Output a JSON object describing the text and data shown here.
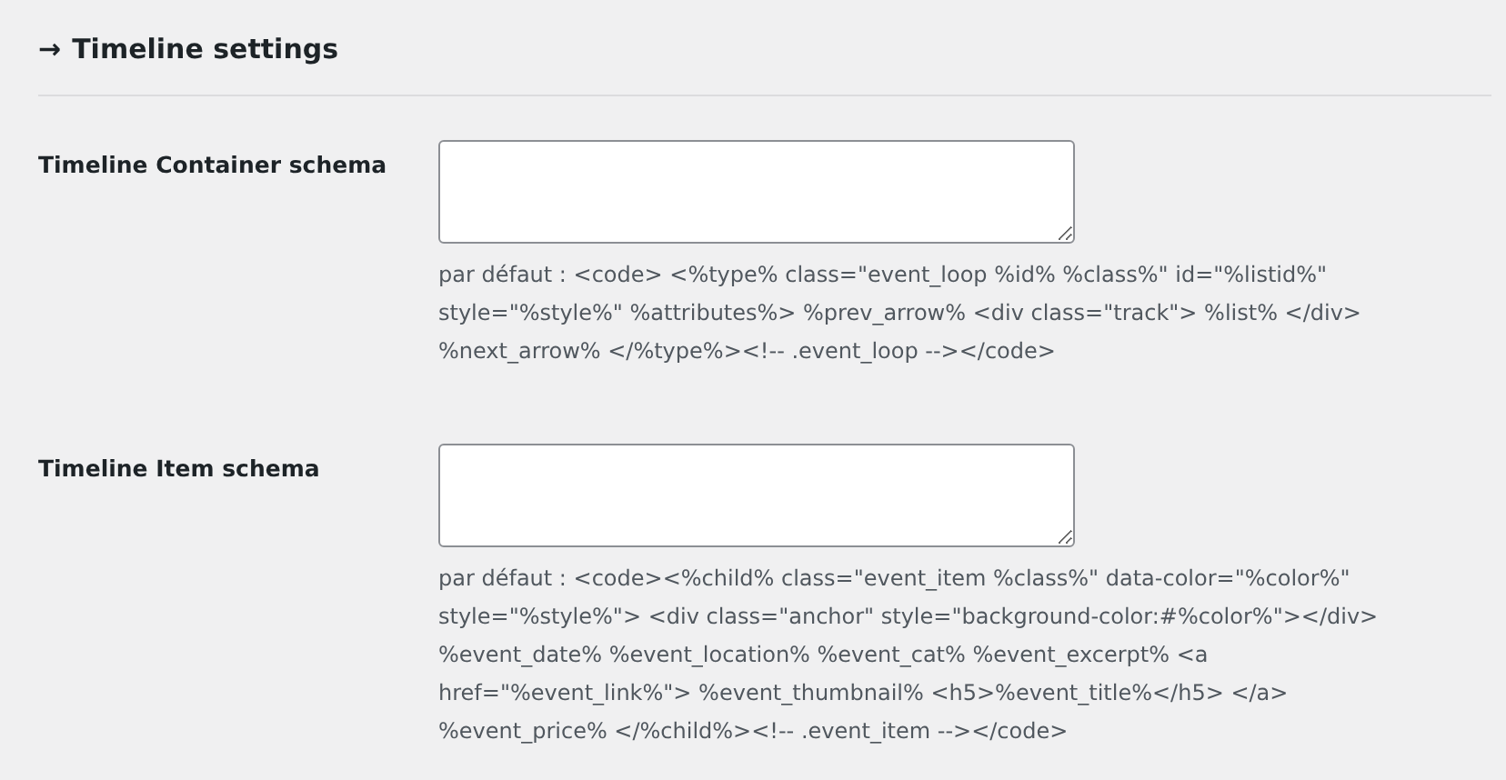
{
  "section": {
    "arrow": "→",
    "title": "Timeline settings"
  },
  "fields": [
    {
      "label": "Timeline Container schema",
      "description_lines": [
        "par défaut : <code> <%type% class=\"event_loop %id% %class%\" id=\"%listid%\"",
        "style=\"%style%\" %attributes%> %prev_arrow% <div class=\"track\"> %list% </div>",
        "%next_arrow% </%type%><!-- .event_loop --></code>"
      ]
    },
    {
      "label": "Timeline Item schema",
      "description_lines": [
        "par défaut : <code><%child% class=\"event_item %class%\" data-color=\"%color%\"",
        "style=\"%style%\"> <div class=\"anchor\" style=\"background-color:#%color%\"></div>",
        "%event_date% %event_location% %event_cat% %event_excerpt% <a",
        "href=\"%event_link%\"> %event_thumbnail% <h5>%event_title%</h5> </a>",
        "%event_price% </%child%><!-- .event_item --></code>"
      ]
    }
  ]
}
